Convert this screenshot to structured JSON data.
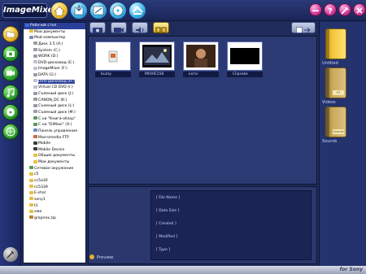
{
  "app": {
    "title": "ImageMixer"
  },
  "top_buttons": [
    {
      "name": "home-icon",
      "color": "#f2c230"
    },
    {
      "name": "import-icon",
      "color": "#42b6e8"
    },
    {
      "name": "edit-icon",
      "color": "#42b6e8"
    },
    {
      "name": "disc-icon",
      "color": "#42b6e8"
    },
    {
      "name": "export-icon",
      "color": "#42b6e8"
    }
  ],
  "window_buttons": [
    "minimize-icon",
    "help-icon",
    "tools-icon",
    "close-icon"
  ],
  "left_buttons": [
    "folder-icon",
    "camera-icon",
    "video-icon",
    "music-icon",
    "disc-icon",
    "web-icon"
  ],
  "tree": {
    "items": [
      {
        "label": "Рабочий стол",
        "indent": 0,
        "selected": true,
        "icon": "desktop"
      },
      {
        "label": "Мои документы",
        "indent": 1,
        "icon": "folder"
      },
      {
        "label": "Мой компьютер",
        "indent": 1,
        "icon": "computer"
      },
      {
        "label": "Диск 3.5 (A:)",
        "indent": 2,
        "icon": "drive"
      },
      {
        "label": "System (C:)",
        "indent": 2,
        "icon": "drive"
      },
      {
        "label": "WORK (D:)",
        "indent": 2,
        "icon": "drive"
      },
      {
        "label": "DVD-дисковод (E:)",
        "indent": 2,
        "icon": "cd"
      },
      {
        "label": "ImageMixer (F:)",
        "indent": 2,
        "icon": "cd"
      },
      {
        "label": "DATA (G:)",
        "indent": 2,
        "icon": "drive"
      },
      {
        "label": "DVD-дисковод (H:)",
        "indent": 2,
        "icon": "cd",
        "selected": true
      },
      {
        "label": "Virtual CD DVD (I:)",
        "indent": 2,
        "icon": "cd"
      },
      {
        "label": "Съемный диск (J:)",
        "indent": 2,
        "icon": "drive"
      },
      {
        "label": "CANON_DC (K:)",
        "indent": 2,
        "icon": "drive"
      },
      {
        "label": "Съемный диск (L:)",
        "indent": 2,
        "icon": "drive"
      },
      {
        "label": "Съемный диск (M:)",
        "indent": 2,
        "icon": "drive"
      },
      {
        "label": "С на \"Книга-обзор\"",
        "indent": 2,
        "icon": "net"
      },
      {
        "label": "С на \"DiMaxi\" (X:)",
        "indent": 2,
        "icon": "net"
      },
      {
        "label": "Панель управления",
        "indent": 2,
        "icon": "panel"
      },
      {
        "label": "Macromedia FTP",
        "indent": 2,
        "icon": "ftp"
      },
      {
        "label": "Mobile",
        "indent": 2,
        "icon": "mobile"
      },
      {
        "label": "Mobile Device",
        "indent": 2,
        "icon": "mobile"
      },
      {
        "label": "Общие документы",
        "indent": 2,
        "icon": "folder"
      },
      {
        "label": "Мои документы",
        "indent": 2,
        "icon": "folder"
      },
      {
        "label": "Сетевое окружение",
        "indent": 1,
        "icon": "net"
      },
      {
        "label": "c5",
        "indent": 1,
        "icon": "folder"
      },
      {
        "label": "cc5a30",
        "indent": 1,
        "icon": "folder"
      },
      {
        "label": "cc5339",
        "indent": 1,
        "icon": "folder"
      },
      {
        "label": "E-shal",
        "indent": 1,
        "icon": "folder"
      },
      {
        "label": "sony1",
        "indent": 1,
        "icon": "folder"
      },
      {
        "label": "t1",
        "indent": 1,
        "icon": "folder"
      },
      {
        "label": "xwo",
        "indent": 1,
        "icon": "folder"
      },
      {
        "label": "grapnex.zip",
        "indent": 1,
        "icon": "zip"
      }
    ]
  },
  "thumbnails": [
    {
      "name": "buzzy",
      "kind": "icon"
    },
    {
      "name": "MOVIE158",
      "kind": "video"
    },
    {
      "name": "коти",
      "kind": "photo"
    },
    {
      "name": "Clipsake",
      "kind": "video-dark"
    }
  ],
  "preview": {
    "label": "Preview",
    "fields": [
      "[ File Name ]",
      "[ Data Size ]",
      "[ Created ]",
      "[ Modified ]",
      "[ Type ]"
    ]
  },
  "albums": [
    {
      "label": "Untitled",
      "tag": "",
      "color": "#f2c53a"
    },
    {
      "label": "Videos",
      "tag": "97",
      "color": "#c9a85a"
    },
    {
      "label": "Sounds",
      "tag": "Sounds",
      "color": "#c9a85a"
    }
  ],
  "footer": {
    "brand": "for Sony"
  }
}
